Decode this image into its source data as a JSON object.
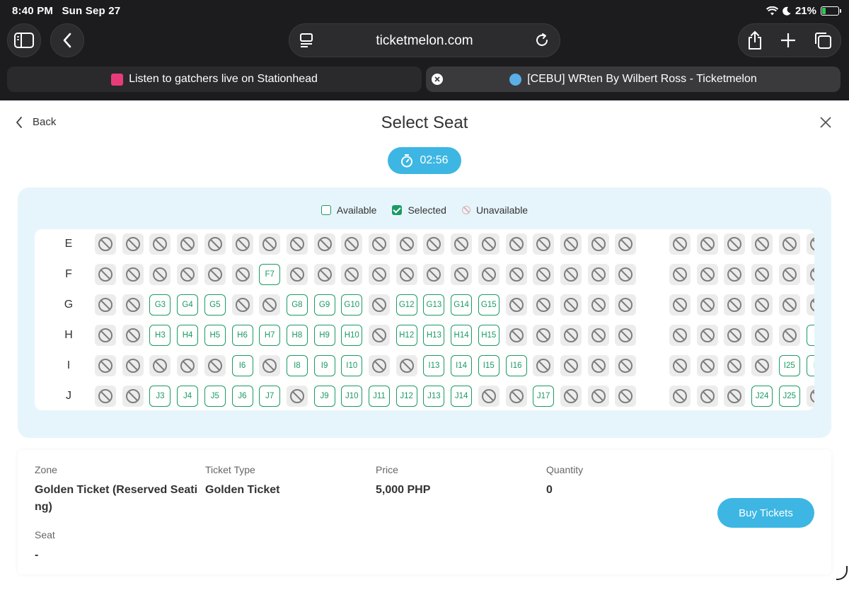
{
  "status_bar": {
    "time": "8:40 PM",
    "date": "Sun Sep 27",
    "battery": "21%",
    "battery_level": 0.21
  },
  "browser": {
    "url": "ticketmelon.com",
    "tabs": [
      {
        "title": "Listen to gatchers live on Stationhead",
        "active": false
      },
      {
        "title": "[CEBU] WRten By Wilbert Ross - Ticketmelon",
        "active": true
      }
    ]
  },
  "header": {
    "back_label": "Back",
    "title": "Select Seat"
  },
  "timer": {
    "value": "02:56"
  },
  "legend": {
    "available": "Available",
    "selected": "Selected",
    "unavailable": "Unavailable"
  },
  "seat_rows": [
    {
      "label": "E",
      "seats": []
    },
    {
      "label": "F",
      "seats": [
        {
          "col": 7,
          "label": "F7"
        }
      ]
    },
    {
      "label": "G",
      "seats": [
        {
          "col": 3,
          "label": "G3"
        },
        {
          "col": 4,
          "label": "G4"
        },
        {
          "col": 5,
          "label": "G5"
        },
        {
          "col": 8,
          "label": "G8"
        },
        {
          "col": 9,
          "label": "G9"
        },
        {
          "col": 10,
          "label": "G10"
        },
        {
          "col": 12,
          "label": "G12"
        },
        {
          "col": 13,
          "label": "G13"
        },
        {
          "col": 14,
          "label": "G14"
        },
        {
          "col": 15,
          "label": "G15"
        }
      ]
    },
    {
      "label": "H",
      "seats": [
        {
          "col": 3,
          "label": "H3"
        },
        {
          "col": 4,
          "label": "H4"
        },
        {
          "col": 5,
          "label": "H5"
        },
        {
          "col": 6,
          "label": "H6"
        },
        {
          "col": 7,
          "label": "H7"
        },
        {
          "col": 8,
          "label": "H8"
        },
        {
          "col": 9,
          "label": "H9"
        },
        {
          "col": 10,
          "label": "H10"
        },
        {
          "col": 12,
          "label": "H12"
        },
        {
          "col": 13,
          "label": "H13"
        },
        {
          "col": 14,
          "label": "H14"
        },
        {
          "col": 15,
          "label": "H15"
        },
        {
          "col": 26,
          "label": "H"
        }
      ]
    },
    {
      "label": "I",
      "seats": [
        {
          "col": 6,
          "label": "I6"
        },
        {
          "col": 8,
          "label": "I8"
        },
        {
          "col": 9,
          "label": "I9"
        },
        {
          "col": 10,
          "label": "I10"
        },
        {
          "col": 13,
          "label": "I13"
        },
        {
          "col": 14,
          "label": "I14"
        },
        {
          "col": 15,
          "label": "I15"
        },
        {
          "col": 16,
          "label": "I16"
        },
        {
          "col": 25,
          "label": "I25"
        },
        {
          "col": 26,
          "label": "I2"
        }
      ]
    },
    {
      "label": "J",
      "seats": [
        {
          "col": 3,
          "label": "J3"
        },
        {
          "col": 4,
          "label": "J4"
        },
        {
          "col": 5,
          "label": "J5"
        },
        {
          "col": 6,
          "label": "J6"
        },
        {
          "col": 7,
          "label": "J7"
        },
        {
          "col": 9,
          "label": "J9"
        },
        {
          "col": 10,
          "label": "J10"
        },
        {
          "col": 11,
          "label": "J11"
        },
        {
          "col": 12,
          "label": "J12"
        },
        {
          "col": 13,
          "label": "J13"
        },
        {
          "col": 14,
          "label": "J14"
        },
        {
          "col": 17,
          "label": "J17"
        },
        {
          "col": 24,
          "label": "J24"
        },
        {
          "col": 25,
          "label": "J25"
        }
      ]
    }
  ],
  "info": {
    "zone_label": "Zone",
    "zone_value_line1": "Golden Ticket (Reserved Seati",
    "zone_value_line2": "ng)",
    "ticket_type_label": "Ticket Type",
    "ticket_type_value": "Golden Ticket",
    "price_label": "Price",
    "price_value": "5,000 PHP",
    "quantity_label": "Quantity",
    "quantity_value": "0",
    "seat_label": "Seat",
    "seat_value": "-",
    "buy_label": "Buy Tickets"
  },
  "colors": {
    "accent": "#3db6e3",
    "available": "#1a9b62",
    "panel_bg": "#e6f5fc",
    "chrome_bg": "#1c1c1e"
  }
}
